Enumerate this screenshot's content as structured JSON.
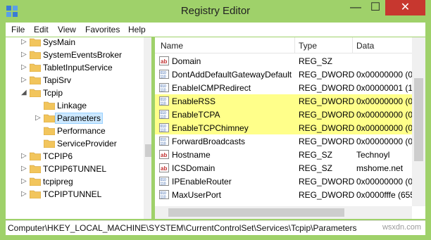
{
  "window": {
    "title": "Registry Editor",
    "min_glyph": "—",
    "max_glyph": "☐",
    "close_glyph": "✕",
    "accent": "#9fd16a"
  },
  "menu": [
    "File",
    "Edit",
    "View",
    "Favorites",
    "Help"
  ],
  "tree": [
    {
      "label": "SysMain",
      "arrow": "▷",
      "level": 0
    },
    {
      "label": "SystemEventsBroker",
      "arrow": "▷",
      "level": 0
    },
    {
      "label": "TabletInputService",
      "arrow": "▷",
      "level": 0
    },
    {
      "label": "TapiSrv",
      "arrow": "▷",
      "level": 0
    },
    {
      "label": "Tcpip",
      "arrow": "◢",
      "level": 0
    },
    {
      "label": "Linkage",
      "arrow": "",
      "level": 1
    },
    {
      "label": "Parameters",
      "arrow": "▷",
      "level": 1,
      "selected": true
    },
    {
      "label": "Performance",
      "arrow": "",
      "level": 1
    },
    {
      "label": "ServiceProvider",
      "arrow": "",
      "level": 1
    },
    {
      "label": "TCPIP6",
      "arrow": "▷",
      "level": 0
    },
    {
      "label": "TCPIP6TUNNEL",
      "arrow": "▷",
      "level": 0
    },
    {
      "label": "tcpipreg",
      "arrow": "▷",
      "level": 0
    },
    {
      "label": "TCPIPTUNNEL",
      "arrow": "▷",
      "level": 0
    }
  ],
  "columns": {
    "name": "Name",
    "type": "Type",
    "data": "Data"
  },
  "values": [
    {
      "name": "Domain",
      "type": "REG_SZ",
      "data": "",
      "icon": "string"
    },
    {
      "name": "DontAddDefaultGatewayDefault",
      "type": "REG_DWORD",
      "data": "0x00000000 (0)",
      "icon": "binary"
    },
    {
      "name": "EnableICMPRedirect",
      "type": "REG_DWORD",
      "data": "0x00000001 (1)",
      "icon": "binary"
    },
    {
      "name": "EnableRSS",
      "type": "REG_DWORD",
      "data": "0x00000000 (0)",
      "icon": "binary",
      "highlight": true
    },
    {
      "name": "EnableTCPA",
      "type": "REG_DWORD",
      "data": "0x00000000 (0)",
      "icon": "binary",
      "highlight": true
    },
    {
      "name": "EnableTCPChimney",
      "type": "REG_DWORD",
      "data": "0x00000000 (0)",
      "icon": "binary",
      "highlight": true
    },
    {
      "name": "ForwardBroadcasts",
      "type": "REG_DWORD",
      "data": "0x00000000 (0)",
      "icon": "binary"
    },
    {
      "name": "Hostname",
      "type": "REG_SZ",
      "data": "Technoyl",
      "icon": "string"
    },
    {
      "name": "ICSDomain",
      "type": "REG_SZ",
      "data": "mshome.net",
      "icon": "string"
    },
    {
      "name": "IPEnableRouter",
      "type": "REG_DWORD",
      "data": "0x00000000 (0)",
      "icon": "binary"
    },
    {
      "name": "MaxUserPort",
      "type": "REG_DWORD",
      "data": "0x0000fffe (655",
      "icon": "binary"
    }
  ],
  "status": "Computer\\HKEY_LOCAL_MACHINE\\SYSTEM\\CurrentControlSet\\Services\\Tcpip\\Parameters",
  "watermark": "wsxdn.com",
  "colors": {
    "highlight": "#ffff8a",
    "selection": "#cce8ff",
    "folder": "#f2c55c",
    "close": "#c7372f"
  }
}
